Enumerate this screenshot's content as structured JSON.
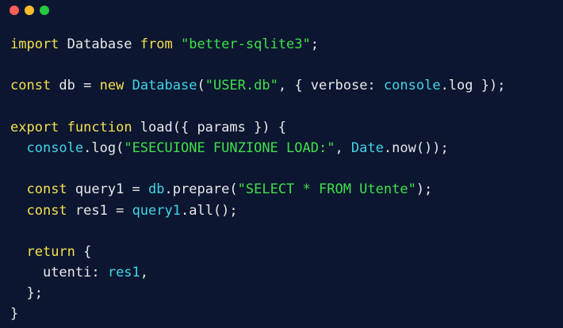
{
  "window": {
    "controls": [
      {
        "name": "close",
        "color": "#ff5f56"
      },
      {
        "name": "minimize",
        "color": "#ffbd2e"
      },
      {
        "name": "maximize",
        "color": "#27c93f"
      }
    ]
  },
  "colors": {
    "background": "#0c1630",
    "keyword": "#f4e04d",
    "string": "#3ee04a",
    "identifier_highlight": "#40d6e8",
    "text": "#e8e8e8"
  },
  "code": {
    "lines": [
      [
        {
          "t": "import",
          "k": "kw"
        },
        {
          "t": " Database ",
          "k": "plain"
        },
        {
          "t": "from",
          "k": "kw"
        },
        {
          "t": " ",
          "k": "plain"
        },
        {
          "t": "\"better-sqlite3\"",
          "k": "str"
        },
        {
          "t": ";",
          "k": "plain"
        }
      ],
      [],
      [
        {
          "t": "const",
          "k": "kw"
        },
        {
          "t": " db = ",
          "k": "plain"
        },
        {
          "t": "new",
          "k": "kw"
        },
        {
          "t": " ",
          "k": "plain"
        },
        {
          "t": "Database",
          "k": "obj"
        },
        {
          "t": "(",
          "k": "plain"
        },
        {
          "t": "\"USER.db\"",
          "k": "str"
        },
        {
          "t": ", { verbose: ",
          "k": "plain"
        },
        {
          "t": "console",
          "k": "obj"
        },
        {
          "t": ".log });",
          "k": "plain"
        }
      ],
      [],
      [
        {
          "t": "export",
          "k": "kw"
        },
        {
          "t": " ",
          "k": "plain"
        },
        {
          "t": "function",
          "k": "kw"
        },
        {
          "t": " load({ params }) {",
          "k": "plain"
        }
      ],
      [
        {
          "t": "  ",
          "k": "plain"
        },
        {
          "t": "console",
          "k": "obj"
        },
        {
          "t": ".log(",
          "k": "plain"
        },
        {
          "t": "\"ESECUIONE FUNZIONE LOAD:\"",
          "k": "str"
        },
        {
          "t": ", ",
          "k": "plain"
        },
        {
          "t": "Date",
          "k": "obj"
        },
        {
          "t": ".now());",
          "k": "plain"
        }
      ],
      [],
      [
        {
          "t": "  ",
          "k": "plain"
        },
        {
          "t": "const",
          "k": "kw"
        },
        {
          "t": " query1 = ",
          "k": "plain"
        },
        {
          "t": "db",
          "k": "obj"
        },
        {
          "t": ".prepare(",
          "k": "plain"
        },
        {
          "t": "\"SELECT * FROM Utente\"",
          "k": "str"
        },
        {
          "t": ");",
          "k": "plain"
        }
      ],
      [
        {
          "t": "  ",
          "k": "plain"
        },
        {
          "t": "const",
          "k": "kw"
        },
        {
          "t": " res1 = ",
          "k": "plain"
        },
        {
          "t": "query1",
          "k": "obj"
        },
        {
          "t": ".all();",
          "k": "plain"
        }
      ],
      [],
      [
        {
          "t": "  ",
          "k": "plain"
        },
        {
          "t": "return",
          "k": "kw"
        },
        {
          "t": " {",
          "k": "plain"
        }
      ],
      [
        {
          "t": "    utenti: ",
          "k": "plain"
        },
        {
          "t": "res1",
          "k": "obj"
        },
        {
          "t": ",",
          "k": "plain"
        }
      ],
      [
        {
          "t": "  };",
          "k": "plain"
        }
      ],
      [
        {
          "t": "}",
          "k": "plain"
        }
      ]
    ]
  }
}
